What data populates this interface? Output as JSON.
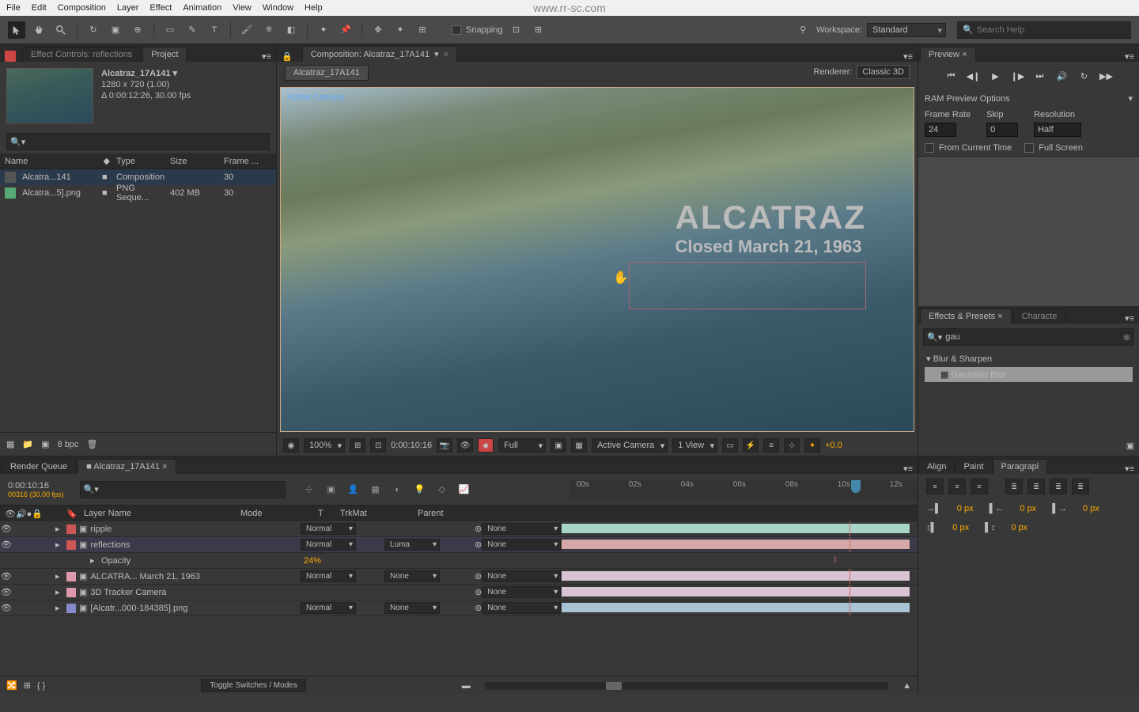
{
  "watermark": "www.rr-sc.com",
  "menubar": [
    "File",
    "Edit",
    "Composition",
    "Layer",
    "Effect",
    "Animation",
    "View",
    "Window",
    "Help"
  ],
  "toolbar": {
    "snapping": "Snapping",
    "workspace_label": "Workspace:",
    "workspace_value": "Standard",
    "search_placeholder": "Search Help"
  },
  "project": {
    "tab_effects": "Effect Controls: reflections",
    "tab_project": "Project",
    "comp_name": "Alcatraz_17A141 ▾",
    "resolution": "1280 x 720 (1.00)",
    "duration": "Δ 0:00:12:26, 30.00 fps",
    "cols": {
      "name": "Name",
      "type": "Type",
      "size": "Size",
      "frame": "Frame ..."
    },
    "items": [
      {
        "name": "Alcatra...141",
        "type": "Composition",
        "size": "",
        "frame": "30"
      },
      {
        "name": "Alcatra...5].png",
        "type": "PNG Seque...",
        "size": "402 MB",
        "frame": "30"
      }
    ],
    "bpc": "8 bpc"
  },
  "comp": {
    "tab": "Composition: Alcatraz_17A141",
    "breadcrumb": "Alcatraz_17A141",
    "renderer_label": "Renderer:",
    "renderer_value": "Classic 3D",
    "active_camera": "Active Camera",
    "title": "ALCATRAZ",
    "subtitle": "Closed March 21, 1963"
  },
  "viewer": {
    "zoom": "100%",
    "time": "0:00:10:16",
    "res": "Full",
    "camera": "Active Camera",
    "views": "1 View",
    "exposure": "+0.0"
  },
  "preview": {
    "tab": "Preview",
    "ram": "RAM Preview Options",
    "framerate_label": "Frame Rate",
    "framerate": "24",
    "skip_label": "Skip",
    "skip": "0",
    "resolution_label": "Resolution",
    "resolution": "Half",
    "from_current": "From Current Time",
    "full_screen": "Full Screen"
  },
  "effects": {
    "tab_effects": "Effects & Presets",
    "tab_character": "Characte",
    "search": "gau",
    "category": "Blur & Sharpen",
    "item": "Gaussian Blur"
  },
  "timeline": {
    "tab_rq": "Render Queue",
    "tab_comp": "Alcatraz_17A141",
    "timecode": "0:00:10:16",
    "timecode_sub": "00316 (30.00 fps)",
    "cols": {
      "layer": "Layer Name",
      "mode": "Mode",
      "trkmat": "TrkMat",
      "parent": "Parent"
    },
    "ticks": [
      "00s",
      "02s",
      "04s",
      "06s",
      "08s",
      "10s",
      "12s"
    ],
    "layers": [
      {
        "color": "#c55",
        "name": "ripple",
        "mode": "Normal",
        "trkmat": "",
        "parent": "None",
        "bar": "#a9d4c8"
      },
      {
        "color": "#c55",
        "name": "reflections",
        "mode": "Normal",
        "trkmat": "Luma",
        "parent": "None",
        "bar": "#d4a8a8",
        "sel": true
      },
      {
        "color": "",
        "name": "Opacity",
        "value": "24%"
      },
      {
        "color": "#d9a",
        "name": "ALCATRA... March 21, 1963",
        "mode": "Normal",
        "trkmat": "None",
        "parent": "None",
        "bar": "#d9c4d4"
      },
      {
        "color": "#d9a",
        "name": "3D Tracker Camera",
        "mode": "",
        "trkmat": "",
        "parent": "None",
        "bar": "#d9c4d4"
      },
      {
        "color": "#88c",
        "name": "[Alcatr...000-184385].png",
        "mode": "Normal",
        "trkmat": "None",
        "parent": "None",
        "bar": "#a8c4d4"
      }
    ],
    "toggle": "Toggle Switches / Modes"
  },
  "align": {
    "tabs": [
      "Align",
      "Paint",
      "Paragrapl"
    ],
    "indent_vals": [
      "0 px",
      "0 px",
      "0 px",
      "0 px",
      "0 px"
    ]
  }
}
